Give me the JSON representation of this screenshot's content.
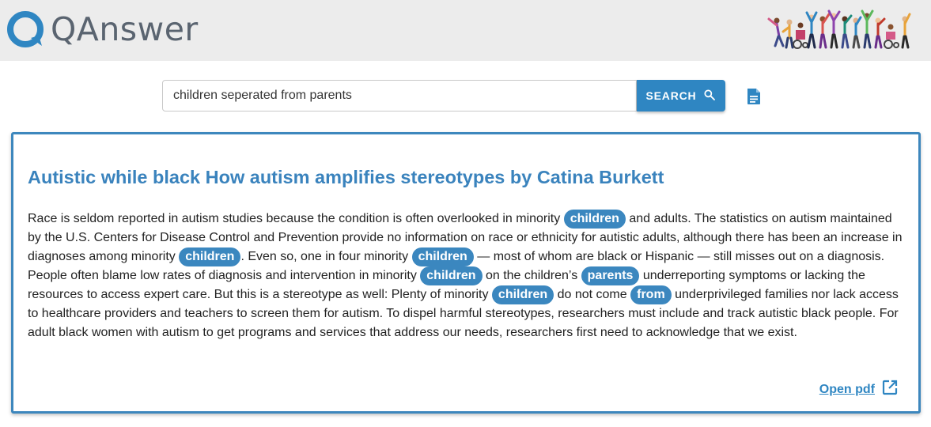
{
  "header": {
    "brand": "QAnswer",
    "icons": {
      "logo": "qanswer-logo-icon",
      "illustration": "diverse-people-illustration"
    }
  },
  "search": {
    "value": "children seperated from parents",
    "button_label": "SEARCH",
    "button_icon": "search-icon",
    "document_icon": "document-icon"
  },
  "result": {
    "title": "Autistic while black How autism amplifies stereotypes by Catina Burkett",
    "segments": [
      {
        "text": "Race is seldom reported in autism studies because the condition is often overlooked in minority ",
        "hl": false
      },
      {
        "text": "children",
        "hl": true
      },
      {
        "text": " and adults. The statistics on autism maintained by the U.S. Centers for Disease Control and Prevention provide no information on race or ethnicity for autistic adults, although there has been an increase in diagnoses among minority ",
        "hl": false
      },
      {
        "text": "children",
        "hl": true
      },
      {
        "text": ". Even so, one in four minority ",
        "hl": false
      },
      {
        "text": "children",
        "hl": true
      },
      {
        "text": " — most of whom are black or Hispanic — still misses out on a diagnosis. People often blame low rates of diagnosis and intervention in minority ",
        "hl": false
      },
      {
        "text": "children",
        "hl": true
      },
      {
        "text": " on the children’s ",
        "hl": false
      },
      {
        "text": "parents",
        "hl": true
      },
      {
        "text": " underreporting symptoms or lacking the resources to access expert care. But this is a stereotype as well: Plenty of minority ",
        "hl": false
      },
      {
        "text": "children",
        "hl": true
      },
      {
        "text": " do not come ",
        "hl": false
      },
      {
        "text": "from",
        "hl": true
      },
      {
        "text": " underprivileged families nor lack access to healthcare providers and teachers to screen them for autism. To dispel harmful stereotypes, researchers must include and track autistic black people. For adult black women with autism to get programs and services that address our needs, researchers first need to acknowledge that we exist.",
        "hl": false
      }
    ],
    "open_pdf_label": "Open pdf",
    "open_pdf_icon": "open-in-new-icon"
  },
  "colors": {
    "header_bg": "#ececec",
    "accent": "#2f86c2",
    "title": "#3a83bd",
    "highlight": "#3b87bf"
  }
}
